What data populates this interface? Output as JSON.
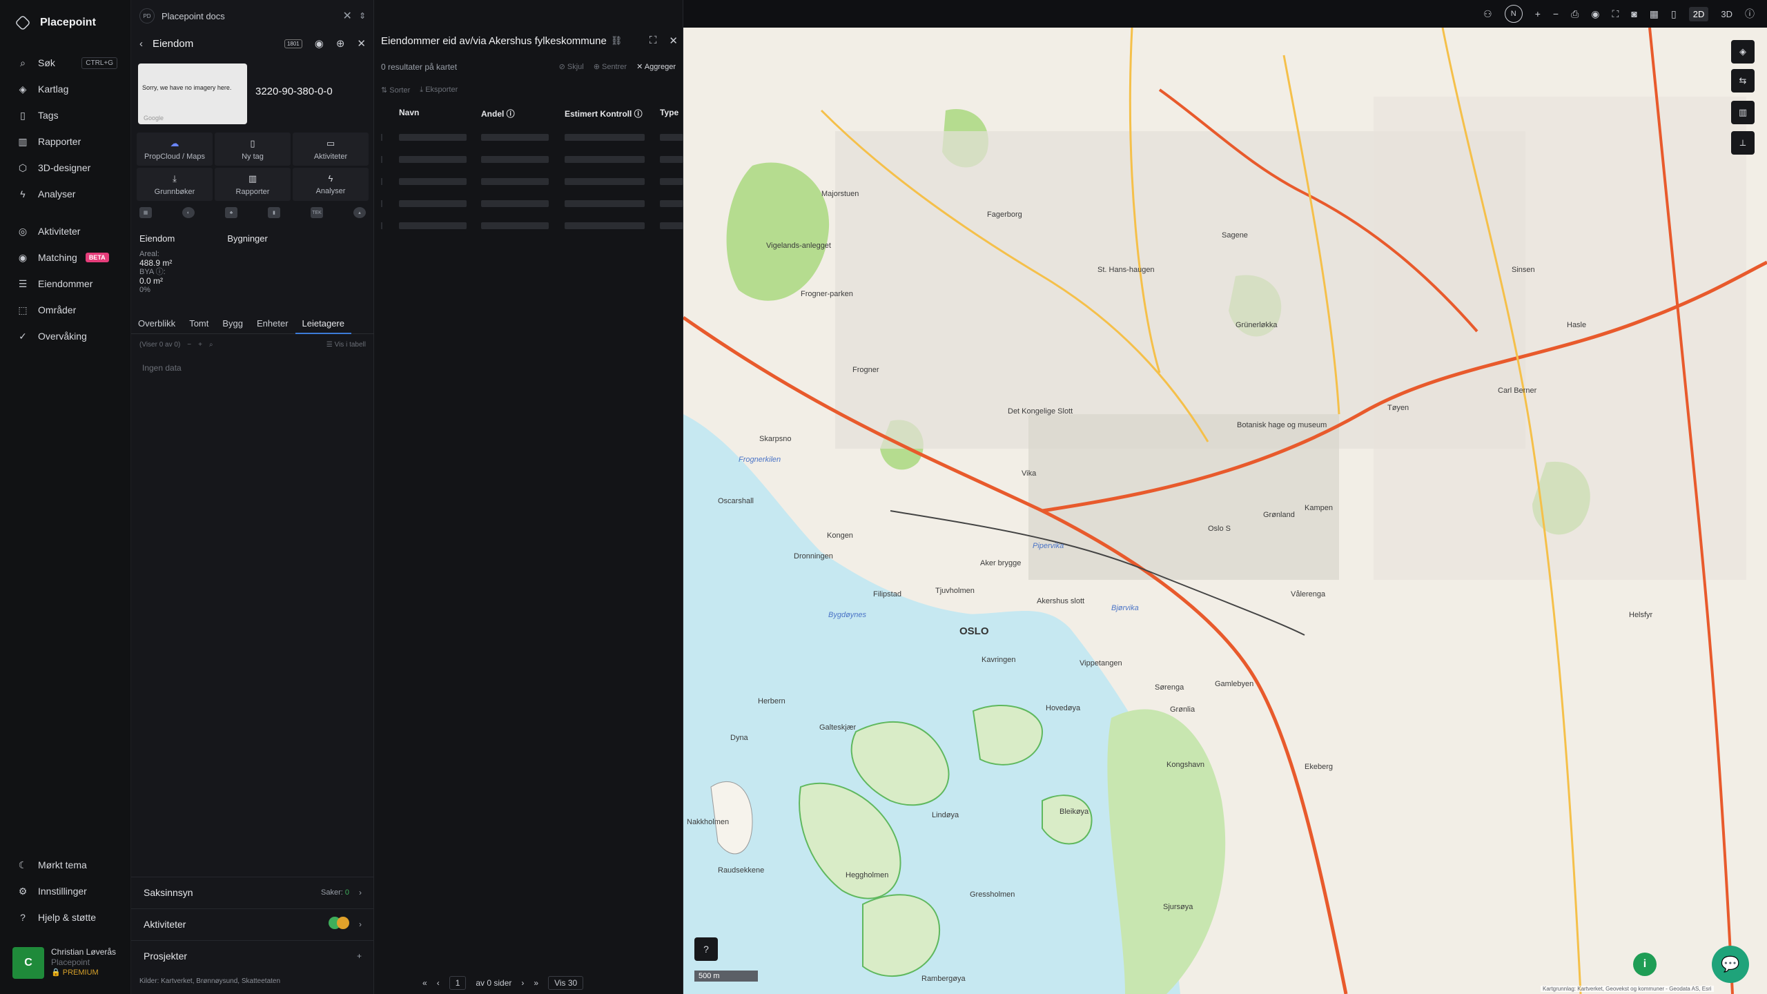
{
  "nav": {
    "brand": "Placepoint",
    "items": [
      {
        "label": "Søk",
        "icon": "search-icon",
        "kbd": "CTRL+G"
      },
      {
        "label": "Kartlag",
        "icon": "layers-icon"
      },
      {
        "label": "Tags",
        "icon": "bookmark-icon"
      },
      {
        "label": "Rapporter",
        "icon": "chart-icon"
      },
      {
        "label": "3D-designer",
        "icon": "cube-icon"
      },
      {
        "label": "Analyser",
        "icon": "bolt-icon"
      }
    ],
    "items2": [
      {
        "label": "Aktiviteter",
        "icon": "activity-icon"
      },
      {
        "label": "Matching",
        "icon": "target-icon",
        "badge": "BETA"
      },
      {
        "label": "Eiendommer",
        "icon": "list-icon"
      },
      {
        "label": "Områder",
        "icon": "area-icon"
      },
      {
        "label": "Overvåking",
        "icon": "check-circle-icon"
      }
    ],
    "bottom": [
      {
        "label": "Mørkt tema",
        "icon": "moon-icon"
      },
      {
        "label": "Innstillinger",
        "icon": "gear-icon"
      },
      {
        "label": "Hjelp & støtte",
        "icon": "help-icon"
      }
    ],
    "user": {
      "initial": "C",
      "name": "Christian Løverås",
      "org": "Placepoint",
      "plan": "PREMIUM"
    }
  },
  "panel": {
    "doc_badge": "PD",
    "doc_title": "Placepoint docs",
    "title": "Eiendom",
    "tag_code": "1801",
    "thumb_text": "Sorry, we have no imagery here.",
    "thumb_brand": "Google",
    "property_id": "3220-90-380-0-0",
    "tiles": [
      {
        "label": "PropCloud / Maps",
        "icon": "cloud-icon"
      },
      {
        "label": "Ny tag",
        "icon": "bookmark-icon"
      },
      {
        "label": "Aktiviteter",
        "icon": "chat-icon"
      },
      {
        "label": "Grunnbøker",
        "icon": "download-icon"
      },
      {
        "label": "Rapporter",
        "icon": "chart-icon"
      },
      {
        "label": "Analyser",
        "icon": "bolt-icon"
      }
    ],
    "mini_tex": "TEK",
    "subtabs": [
      "Eiendom",
      "Bygninger"
    ],
    "stats": {
      "areal_label": "Areal:",
      "areal_value": "488.9",
      "areal_unit": "m²",
      "bya_label": "BYA ⓘ:",
      "bya_value": "0.0",
      "bya_unit": "m²",
      "pct": "0%"
    },
    "tabs": [
      "Overblikk",
      "Tomt",
      "Bygg",
      "Enheter",
      "Leietagere"
    ],
    "active_tab": "Leietagere",
    "list_info": "(Viser 0 av 0)",
    "list_table": "Vis i tabell",
    "empty_text": "Ingen data",
    "accordions": [
      {
        "label": "Saksinnsyn",
        "meta_label": "Saker:",
        "meta_value": "0"
      },
      {
        "label": "Aktiviteter"
      },
      {
        "label": "Prosjekter"
      }
    ],
    "sources_label": "Kilder:",
    "sources": [
      "Kartverket,",
      "Brønnøysund,",
      "Skatteetaten"
    ]
  },
  "results": {
    "title": "Eiendommer eid av/via Akershus fylkeskommune",
    "count": "0 resultater på kartet",
    "actions": {
      "hide": "Skjul",
      "center": "Sentrer",
      "aggregate": "Aggreger"
    },
    "sort": "Sorter",
    "export": "Eksporter",
    "columns": [
      "Navn",
      "Andel ⓘ",
      "Estimert Kontroll ⓘ",
      "Type"
    ],
    "pager": {
      "page": "1",
      "of": "av 0 sider",
      "per": "Vis 30"
    }
  },
  "map": {
    "labels": [
      "Majorstuen",
      "Fagerborg",
      "St. Hans-haugen",
      "Frogner",
      "Vigelands-anlegget",
      "Frogner-parken",
      "Det Kongelige Slott",
      "Vika",
      "Aker brygge",
      "Akershus slott",
      "OSLO",
      "Oslo S",
      "Grønland",
      "Tøyen",
      "Kampen",
      "Vålerenga",
      "Gamlebyen",
      "Ekeberg",
      "Bygdøynes",
      "Dronningen",
      "Kongen",
      "Filipstad",
      "Tjuvholmen",
      "Pipervika",
      "Bjørvika",
      "Hovedøya",
      "Lindøya",
      "Bleikøya",
      "Gressholmen",
      "Heggholmen",
      "Rambergøya",
      "Nakkholmen",
      "Raudsekkene",
      "Dyna",
      "Galteskjær",
      "Herbern",
      "Sørenga",
      "Grønlia",
      "Sjursøya",
      "Kongshavn",
      "Grünerløkka",
      "Sagene",
      "Sinsen",
      "Hasle",
      "Carl Berner",
      "Helsfyr",
      "Botanisk hage og museum",
      "Frognerkilen",
      "Skarpsno",
      "Oscarshall",
      "Kavringen",
      "Vippetangen"
    ],
    "scale": "500 m",
    "attribution": "Kartgrunnlag: Kartverket, Geovekst og kommuner - Geodata AS, Esri"
  },
  "topbar": {
    "compass": "N",
    "mode_2d": "2D",
    "mode_3d": "3D"
  }
}
